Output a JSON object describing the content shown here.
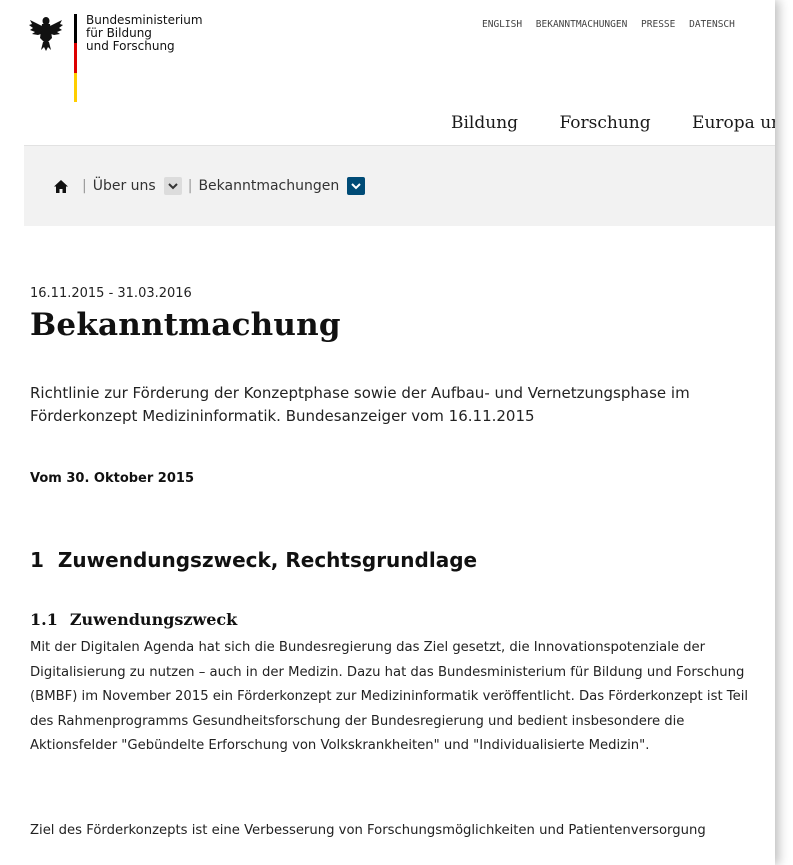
{
  "header": {
    "logo_lines": [
      "Bundesministerium",
      "für Bildung",
      "und Forschung"
    ],
    "meta_nav": [
      "ENGLISH",
      "BEKANNTMACHUNGEN",
      "PRESSE",
      "DATENSCH"
    ],
    "main_nav": [
      "Bildung",
      "Forschung",
      "Europa und"
    ],
    "flag_colors": [
      "#000000",
      "#dd0000",
      "#ffce00"
    ]
  },
  "breadcrumb": {
    "items": [
      "Über uns",
      "Bekanntmachungen"
    ],
    "separator": "|"
  },
  "article": {
    "date_range": "16.11.2015 - 31.03.2016",
    "title": "Bekanntmachung",
    "lead": "Richtlinie zur Förderung der Konzeptphase sowie der Aufbau- und Vernetzungsphase im Förderkonzept Medizininformatik. Bundesanzeiger vom 16.11.2015",
    "subdate": "Vom 30. Oktober 2015",
    "section1_num": "1",
    "section1_title": "Zuwendungszweck, Rechtsgrundlage",
    "section11_num": "1.1",
    "section11_title": "Zuwendungszweck",
    "paragraph1": "Mit der Digitalen Agenda hat sich die Bundesregierung das Ziel gesetzt, die Innovationspotenziale der Digitalisierung zu nutzen – auch in der Medizin. Dazu hat das Bundesministerium für Bildung und Forschung (BMBF) im November 2015 ein Förderkonzept zur Medizininformatik veröffentlicht. Das Förderkonzept ist Teil des Rahmenprogramms Gesundheitsforschung der Bundesregierung und bedient insbesondere die Aktionsfelder \"Gebündelte Erforschung von Volkskrankheiten\" und \"Individualisierte Medizin\".",
    "paragraph2": "Ziel des Förderkonzepts ist eine Verbesserung von Forschungsmöglichkeiten und Patientenversorgung"
  },
  "colors": {
    "accent": "#004b76",
    "crumb_bg": "#f2f2f2"
  }
}
